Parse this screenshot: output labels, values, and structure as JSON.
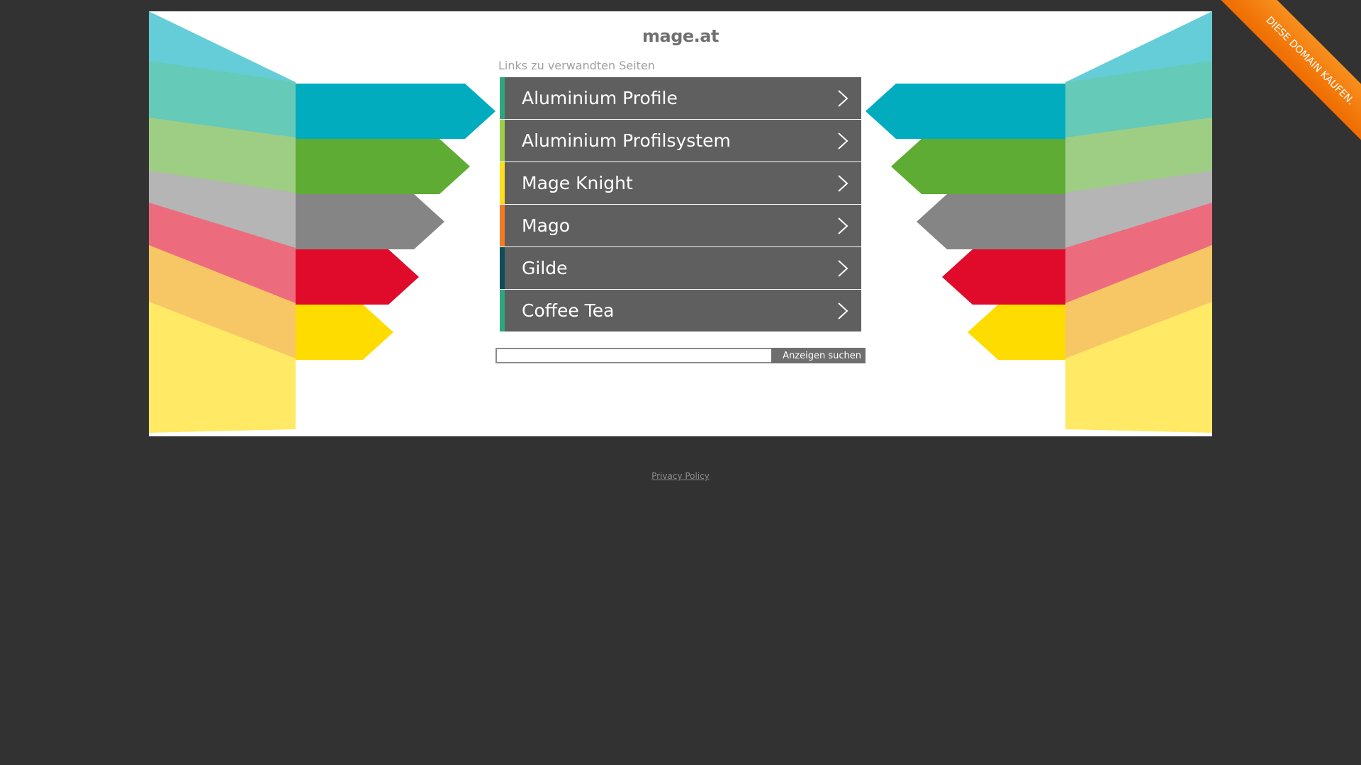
{
  "header": {
    "domain": "mage.at",
    "related_label": "Links zu verwandten Seiten"
  },
  "links": [
    {
      "label": "Aluminium Profile",
      "accent": "#2fa77e"
    },
    {
      "label": "Aluminium Profilsystem",
      "accent": "#9fcf4a"
    },
    {
      "label": "Mage Knight",
      "accent": "#ffdf1b"
    },
    {
      "label": "Mago",
      "accent": "#f47b20"
    },
    {
      "label": "Gilde",
      "accent": "#0f4c5c"
    },
    {
      "label": "Coffee Tea",
      "accent": "#2fa77e"
    }
  ],
  "links_icon": "chevron-right-icon",
  "search": {
    "value": "",
    "placeholder": "",
    "button_label": "Anzeigen suchen"
  },
  "footer": {
    "privacy_label": "Privacy Policy"
  },
  "ribbon": {
    "label": "DIESE DOMAIN KAUFEN.",
    "color": "#f47b20"
  },
  "colors": {
    "page_background": "#323232",
    "card_background": "#ffffff",
    "link_background": "#5f5f5f",
    "decor": [
      "#00acbd",
      "#5eac33",
      "#858585",
      "#e00b2a",
      "#ffdc00"
    ]
  }
}
